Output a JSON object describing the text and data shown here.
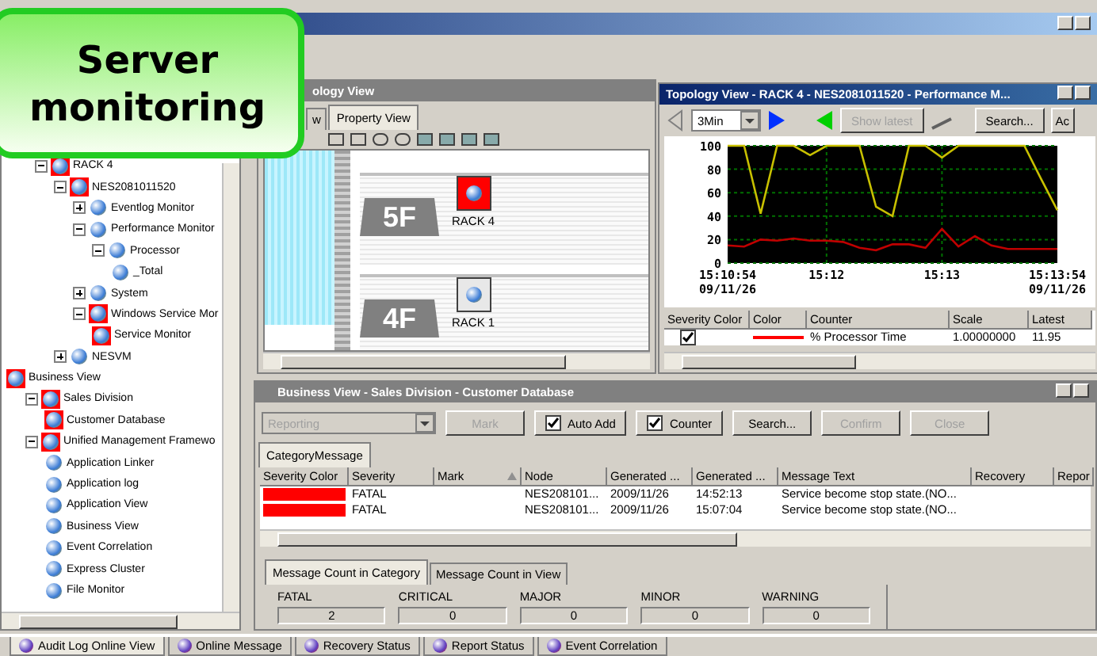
{
  "callout": {
    "lines": [
      "Server",
      "monitoring"
    ]
  },
  "tree": [
    {
      "label": "RACK 4",
      "alert": true,
      "expanded": true,
      "children": [
        {
          "label": "NES2081011520",
          "alert": true,
          "expanded": true,
          "children": [
            {
              "label": "Eventlog Monitor",
              "alert": false,
              "expanded": false
            },
            {
              "label": "Performance Monitor",
              "alert": false,
              "expanded": true,
              "children": [
                {
                  "label": "Processor",
                  "alert": false,
                  "expanded": true,
                  "children": [
                    {
                      "label": "_Total",
                      "alert": false
                    }
                  ]
                }
              ]
            },
            {
              "label": "System",
              "alert": false,
              "expanded": false
            },
            {
              "label": "Windows Service Mor",
              "alert": true,
              "expanded": true,
              "children": [
                {
                  "label": "Service Monitor",
                  "alert": true
                }
              ]
            }
          ]
        },
        {
          "label": "NESVM",
          "alert": false,
          "expanded": false
        }
      ]
    },
    {
      "label": "Business View",
      "alert": true,
      "children": [
        {
          "label": "Sales Division",
          "alert": true,
          "expanded": true,
          "children": [
            {
              "label": "Customer Database",
              "alert": true
            }
          ]
        },
        {
          "label": "Unified Management Framewo",
          "alert": true,
          "expanded": true,
          "children": [
            {
              "label": "Application Linker",
              "alert": false
            },
            {
              "label": "Application log",
              "alert": false
            },
            {
              "label": "Application View",
              "alert": false
            },
            {
              "label": "Business View",
              "alert": false
            },
            {
              "label": "Event Correlation",
              "alert": false
            },
            {
              "label": "Express Cluster",
              "alert": false
            },
            {
              "label": "File Monitor",
              "alert": false
            }
          ]
        }
      ]
    }
  ],
  "topology": {
    "title": "ology View",
    "tabs": [
      {
        "label": "w",
        "selected": false
      },
      {
        "label": "Property View",
        "selected": true
      }
    ],
    "floors": [
      {
        "label": "5F",
        "node": "RACK 4",
        "alert": true
      },
      {
        "label": "4F",
        "node": "RACK 1",
        "alert": false
      }
    ]
  },
  "performance": {
    "title": "Topology View - RACK 4 - NES2081011520 - Performance M...",
    "range": "3Min",
    "show_latest": "Show latest",
    "search": "Search...",
    "cut_button": "Ac",
    "chart_data": {
      "type": "line",
      "categories": [
        "15:10:54 09/11/26",
        null,
        null,
        null,
        null,
        null,
        "15:12",
        null,
        null,
        null,
        null,
        null,
        null,
        "15:13",
        null,
        null,
        null,
        null,
        null,
        null,
        "15:13:54 09/11/26"
      ],
      "ylim": [
        0,
        100
      ],
      "yticks": [
        0,
        20,
        40,
        60,
        80,
        100
      ],
      "grid": true,
      "series": [
        {
          "color": "#c00000",
          "values": [
            15,
            14,
            20,
            19,
            21,
            19,
            19,
            18,
            13,
            11,
            16,
            16,
            13,
            29,
            14,
            23,
            15,
            12,
            12,
            12,
            12
          ]
        },
        {
          "color": "#c8c000",
          "values": [
            100,
            100,
            42,
            100,
            100,
            92,
            100,
            100,
            100,
            48,
            40,
            100,
            100,
            90,
            100,
            100,
            100,
            100,
            100,
            72,
            45
          ]
        }
      ]
    },
    "columns": [
      "Severity Color",
      "Color",
      "Counter",
      "Scale",
      "Latest"
    ],
    "rows": [
      {
        "checked": true,
        "color": "#ff0000",
        "counter": "% Processor Time",
        "scale": "1.00000000",
        "latest": "11.95"
      }
    ]
  },
  "business": {
    "title": "Business View - Sales Division - Customer Database",
    "category": "Reporting",
    "buttons": [
      {
        "kind": "button",
        "label": "Mark",
        "disabled": true
      },
      {
        "kind": "check",
        "label": "Auto Add",
        "checked": true
      },
      {
        "kind": "check",
        "label": "Counter",
        "checked": true
      },
      {
        "kind": "button",
        "label": "Search...",
        "disabled": false
      },
      {
        "kind": "button",
        "label": "Confirm",
        "disabled": true
      },
      {
        "kind": "button",
        "label": "Close",
        "disabled": true
      }
    ],
    "tab": "CategoryMessage",
    "columns": [
      "Severity Color",
      "Severity",
      "Mark",
      "Node",
      "Generated ...",
      "Generated ...",
      "Message Text",
      "Recovery",
      "Repor"
    ],
    "rows": [
      {
        "color": "#ff0000",
        "severity": "FATAL",
        "node": "NES208101...",
        "date": "2009/11/26",
        "time": "14:52:13",
        "text": "Service become stop state.(NO..."
      },
      {
        "color": "#ff0000",
        "severity": "FATAL",
        "node": "NES208101...",
        "date": "2009/11/26",
        "time": "15:07:04",
        "text": "Service become stop state.(NO..."
      }
    ],
    "count_tabs": [
      {
        "label": "Message Count in Category",
        "selected": true
      },
      {
        "label": "Message Count in View",
        "selected": false
      }
    ],
    "counts": [
      {
        "label": "FATAL",
        "value": "2"
      },
      {
        "label": "CRITICAL",
        "value": "0"
      },
      {
        "label": "MAJOR",
        "value": "0"
      },
      {
        "label": "MINOR",
        "value": "0"
      },
      {
        "label": "WARNING",
        "value": "0"
      }
    ]
  },
  "bottom_tabs": [
    {
      "label": "Audit Log Online View",
      "selected": true
    },
    {
      "label": "Online Message",
      "selected": false
    },
    {
      "label": "Recovery Status",
      "selected": false
    },
    {
      "label": "Report Status",
      "selected": false
    },
    {
      "label": "Event Correlation",
      "selected": false
    }
  ]
}
